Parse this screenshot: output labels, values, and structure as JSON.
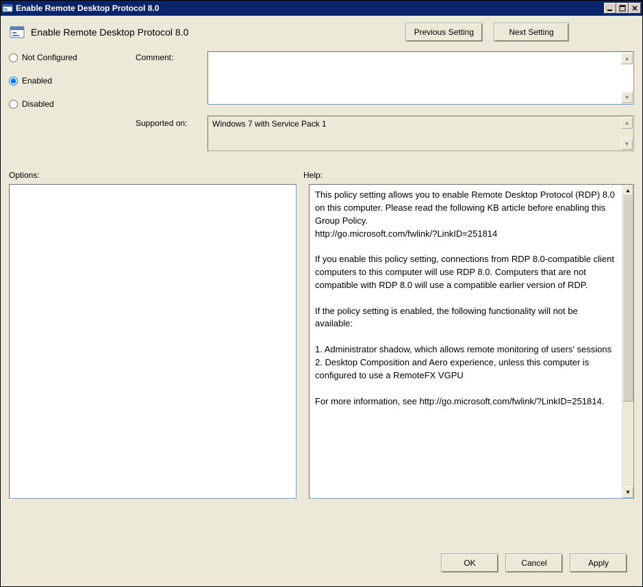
{
  "window": {
    "title": "Enable Remote Desktop Protocol 8.0"
  },
  "header": {
    "title": "Enable Remote Desktop Protocol 8.0",
    "previous_label": "Previous Setting",
    "next_label": "Next Setting"
  },
  "state_radios": {
    "not_configured": "Not Configured",
    "enabled": "Enabled",
    "disabled": "Disabled",
    "selected": "enabled"
  },
  "fields": {
    "comment_label": "Comment:",
    "comment_value": "",
    "supported_label": "Supported on:",
    "supported_value": "Windows 7 with Service Pack 1"
  },
  "panels": {
    "options_label": "Options:",
    "help_label": "Help:",
    "help_text": "This policy setting allows you to enable Remote Desktop Protocol (RDP) 8.0 on this computer. Please read the following KB article before enabling this Group Policy.\nhttp://go.microsoft.com/fwlink/?LinkID=251814\n\nIf you enable this policy setting, connections from RDP 8.0-compatible client computers to this computer will use RDP 8.0. Computers that are not compatible with RDP 8.0 will use a compatible earlier version of RDP.\n\nIf the policy setting is enabled, the following functionality will not be available:\n\n1. Administrator shadow, which allows remote monitoring of users' sessions\n2. Desktop Composition and Aero experience, unless this computer is configured to use a RemoteFX VGPU\n\nFor more information, see http://go.microsoft.com/fwlink/?LinkID=251814."
  },
  "footer": {
    "ok": "OK",
    "cancel": "Cancel",
    "apply": "Apply"
  }
}
